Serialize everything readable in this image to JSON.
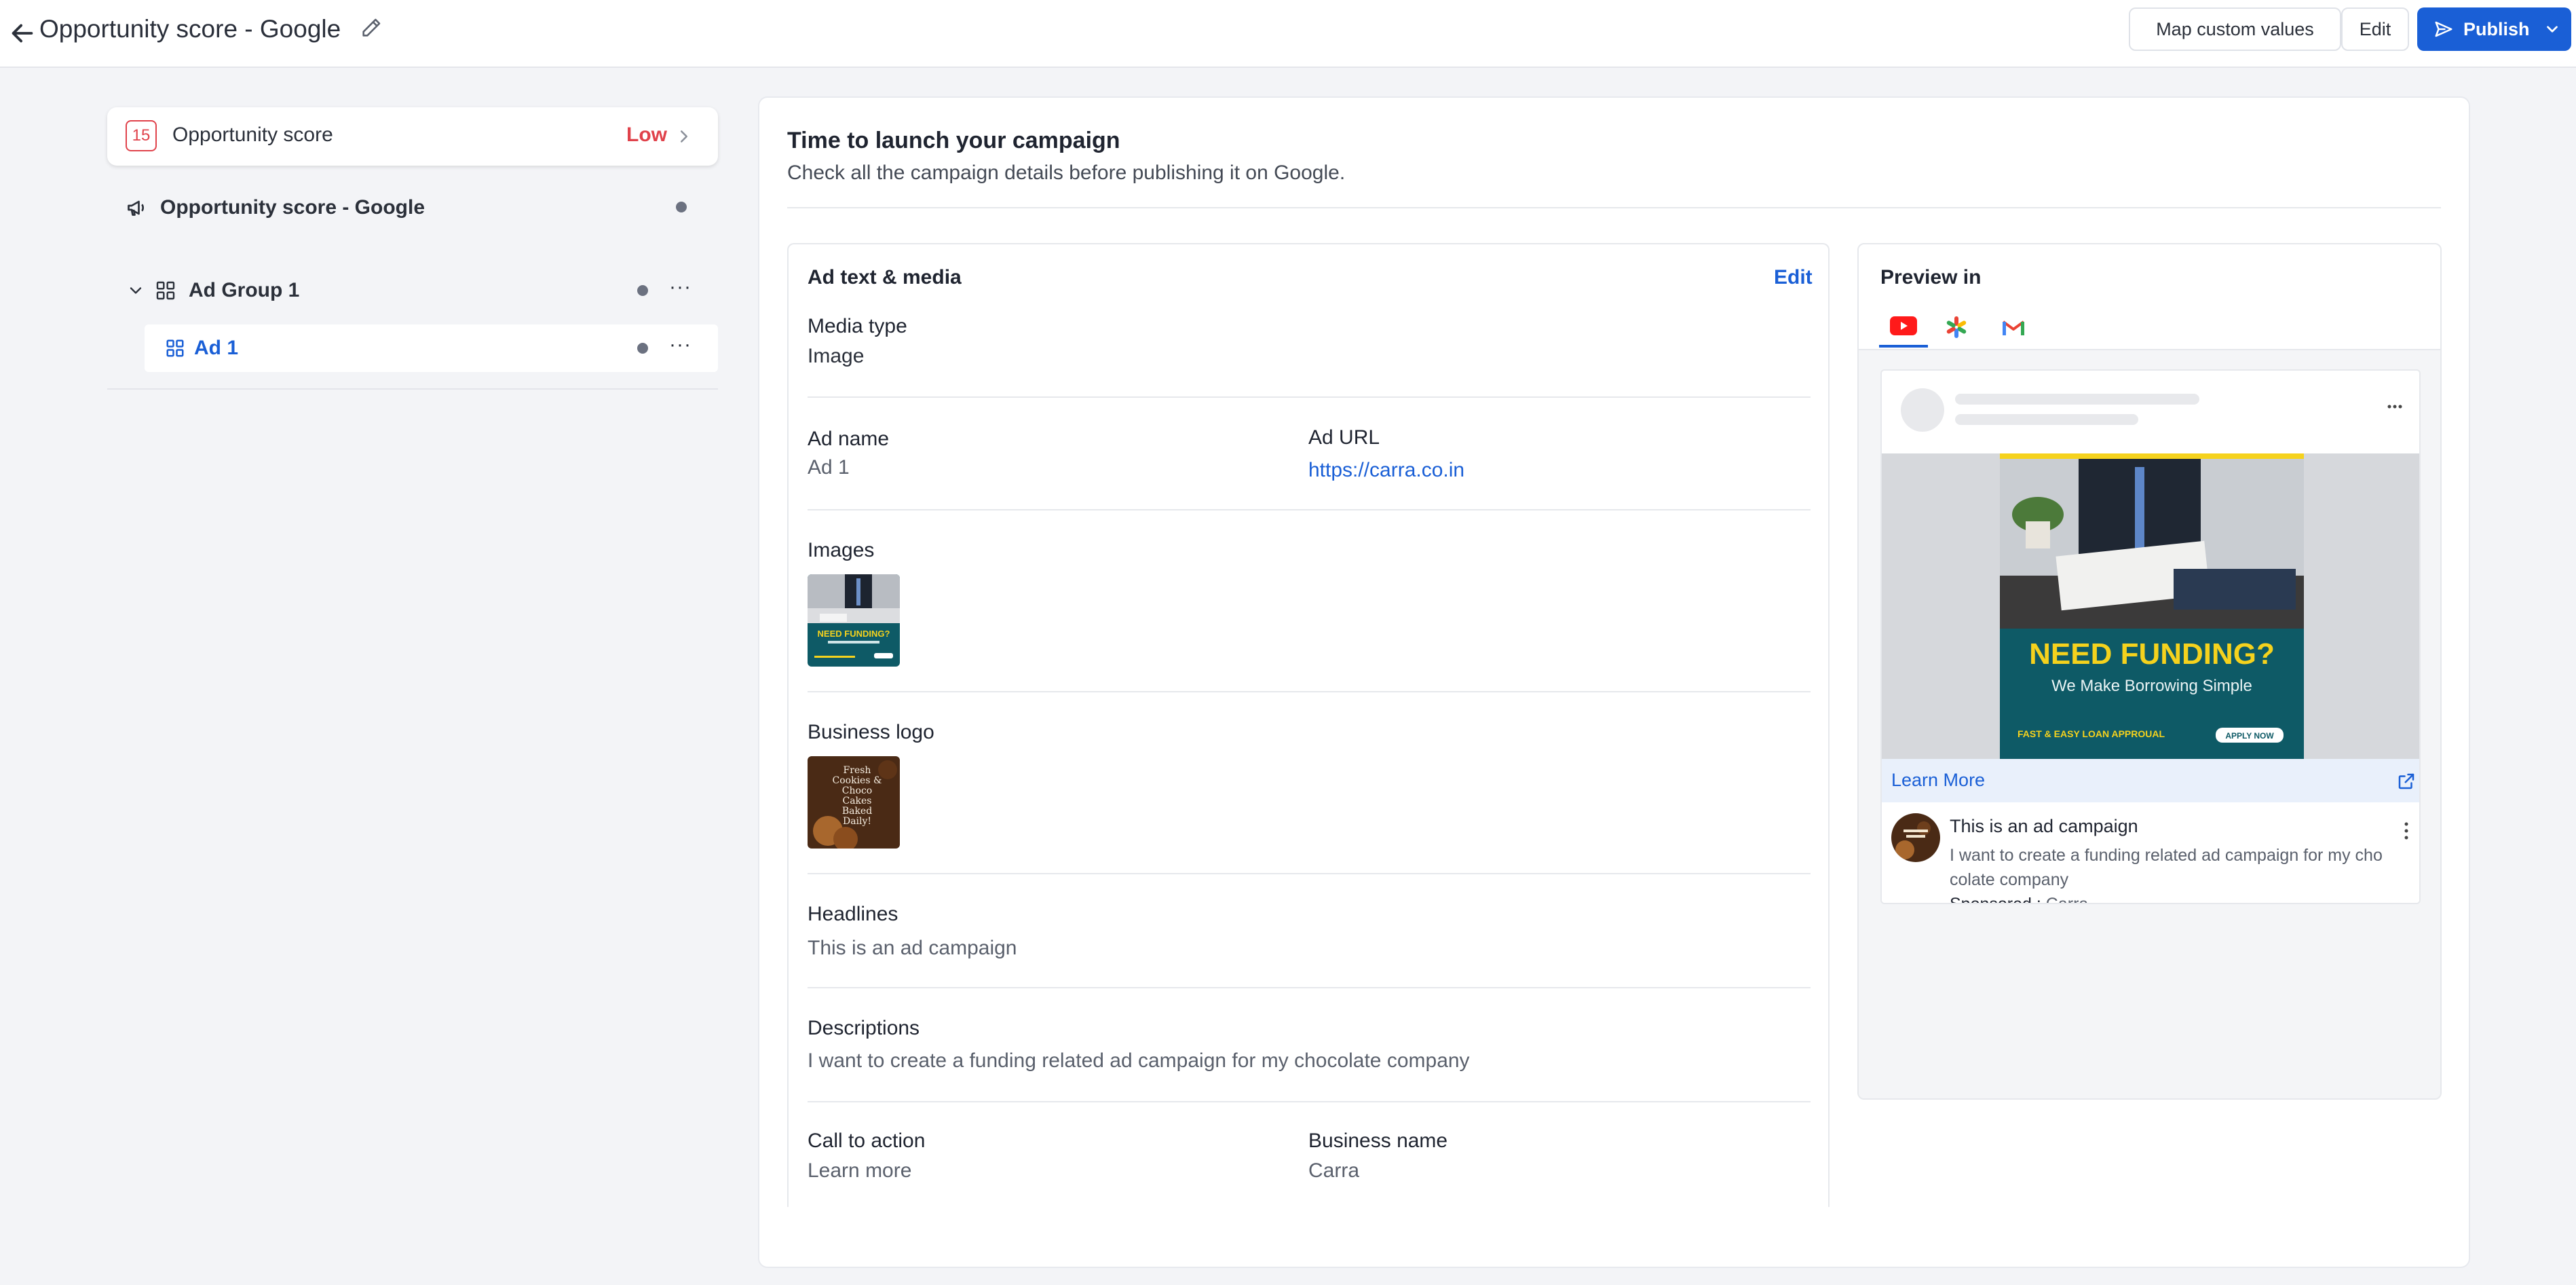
{
  "header": {
    "title": "Opportunity score - Google",
    "map_custom_values_label": "Map custom values",
    "edit_label": "Edit",
    "publish_label": "Publish"
  },
  "sidebar": {
    "score": {
      "value": "15",
      "label": "Opportunity score",
      "level": "Low"
    },
    "campaign": {
      "label": "Opportunity score - Google"
    },
    "ad_group": {
      "label": "Ad Group 1",
      "more": "···"
    },
    "ad": {
      "label": "Ad 1",
      "more": "···"
    }
  },
  "main": {
    "title": "Time to launch your campaign",
    "subtitle": "Check all the campaign details before publishing it on Google."
  },
  "details": {
    "title": "Ad text & media",
    "edit_label": "Edit",
    "media_type": {
      "label": "Media type",
      "value": "Image"
    },
    "ad_name": {
      "label": "Ad name",
      "value": "Ad 1"
    },
    "ad_url": {
      "label": "Ad URL",
      "value": "https://carra.co.in"
    },
    "images": {
      "label": "Images"
    },
    "business_logo": {
      "label": "Business logo"
    },
    "headlines": {
      "label": "Headlines",
      "value": "This is an ad campaign"
    },
    "descriptions": {
      "label": "Descriptions",
      "value": "I want to create a funding related ad campaign for my chocolate company"
    },
    "call_to_action": {
      "label": "Call to action",
      "value": "Learn more"
    },
    "business_name": {
      "label": "Business name",
      "value": "Carra"
    }
  },
  "preview": {
    "title": "Preview in",
    "tabs": [
      "youtube-icon",
      "google-discover-icon",
      "gmail-icon"
    ],
    "banner": {
      "headline": "NEED FUNDING?",
      "subline": "We Make Borrowing Simple",
      "footer": "FAST & EASY LOAN APPROUAL",
      "cta": "APPLY NOW"
    },
    "thumb_small": {
      "headline": "NEED FUNDING?"
    },
    "logo_text": "Fresh Cookies & Choco Cakes Baked Daily!",
    "learn_more": "Learn More",
    "ad_title": "This is an ad campaign",
    "ad_description": "I want to create a funding related ad campaign for my chocolate company",
    "sponsored_label": "Sponsored :",
    "sponsored_by": "Carra"
  },
  "colors": {
    "accent": "#1a5fd6",
    "danger": "#e0424b",
    "banner_teal": "#0e5a66",
    "banner_yellow": "#f5d21d"
  }
}
